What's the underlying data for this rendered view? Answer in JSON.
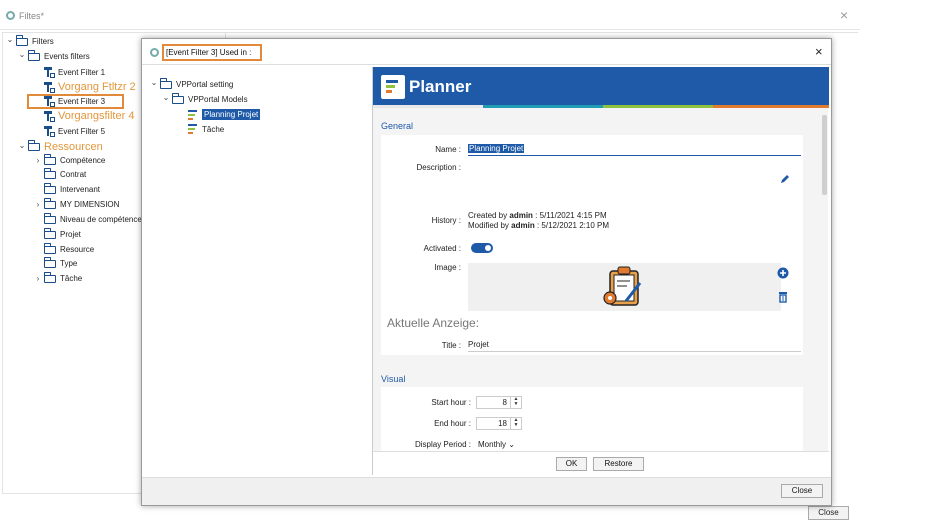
{
  "background_window": {
    "title": "Filtes*",
    "close_glyph": "×",
    "close_button": "Close",
    "tree": [
      {
        "label": "Filters",
        "chev": "v",
        "icon": "folder"
      },
      {
        "label": "Events filters",
        "chev": "v",
        "icon": "folder"
      },
      {
        "label": "Event Filter 1",
        "icon": "filter"
      },
      {
        "label": "Vorgang Ftltzr 2",
        "icon": "filter",
        "annotated": true
      },
      {
        "label": "Event Filter 3",
        "icon": "filter",
        "boxed": true
      },
      {
        "label": "Vorgangsfilter 4",
        "icon": "filter",
        "annotated": true
      },
      {
        "label": "Event Filter 5",
        "icon": "filter"
      },
      {
        "label": "Ressourcen",
        "chev": "v",
        "icon": "folder",
        "annotated": true
      },
      {
        "label": "Compétence",
        "chev": ">",
        "icon": "folder"
      },
      {
        "label": "Contrat",
        "icon": "folder"
      },
      {
        "label": "Intervenant",
        "icon": "folder"
      },
      {
        "label": "MY DIMENSION",
        "chev": ">",
        "icon": "folder"
      },
      {
        "label": "Niveau de compétence",
        "icon": "folder"
      },
      {
        "label": "Projet",
        "icon": "folder"
      },
      {
        "label": "Resource",
        "icon": "folder"
      },
      {
        "label": "Type",
        "icon": "folder"
      },
      {
        "label": "Tâche",
        "chev": ">",
        "icon": "folder"
      }
    ]
  },
  "dialog": {
    "title": "[Event Filter 3] Used in :",
    "close_glyph": "×",
    "close_button": "Close",
    "tree": [
      {
        "label": "VPPortal setting",
        "chev": "v",
        "icon": "folder"
      },
      {
        "label": "VPPortal Models",
        "chev": "v",
        "icon": "folder"
      },
      {
        "label": "Planning Projet",
        "icon": "planner",
        "selected": true
      },
      {
        "label": "Tâche",
        "icon": "planner"
      }
    ]
  },
  "planner": {
    "header_title": "Planner",
    "sections": {
      "general": "General",
      "visual": "Visual"
    },
    "fields": {
      "name_label": "Name :",
      "name_value": "Planning Projet",
      "description_label": "Description :",
      "history_label": "History :",
      "history_created_prefix": "Created by",
      "history_created_user": "admin",
      "history_created_date": ": 5/11/2021 4:15 PM",
      "history_modified_prefix": "Modified by",
      "history_modified_user": "admin",
      "history_modified_date": ": 5/12/2021 2:10 PM",
      "activated_label": "Activated :",
      "image_label": "Image :",
      "aktuelle_anzeige": "Aktuelle Anzeige:",
      "title_label": "Title :",
      "title_value": "Projet",
      "start_hour_label": "Start hour :",
      "start_hour_value": "8",
      "end_hour_label": "End hour :",
      "end_hour_value": "18",
      "display_period_label": "Display Period :",
      "display_period_value": "Monthly"
    },
    "activated": true,
    "footer": {
      "ok": "OK",
      "restore": "Restore"
    },
    "colors": {
      "header": "#1e5aa8",
      "stripe_teal": "#1e9db5",
      "stripe_green": "#8fc23f",
      "stripe_orange": "#e07b2f",
      "annotation": "#e08a3a"
    }
  }
}
